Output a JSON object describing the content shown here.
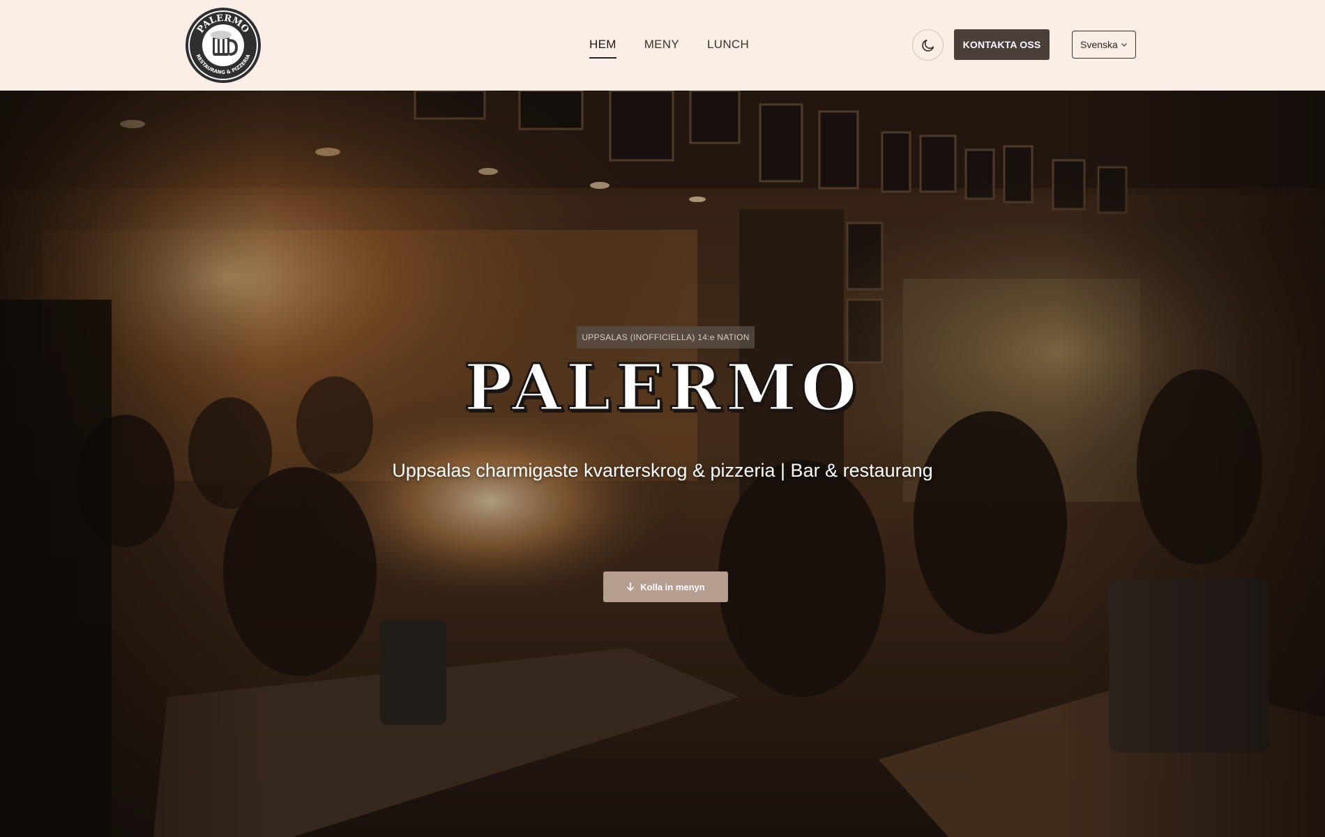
{
  "header": {
    "logo": {
      "text_top": "PALERMO",
      "text_bottom": "RESTAURANG & PIZZERIA"
    },
    "nav": [
      {
        "label": "HEM",
        "active": true
      },
      {
        "label": "MENY",
        "active": false
      },
      {
        "label": "LUNCH",
        "active": false
      }
    ],
    "theme_toggle_icon": "moon-icon",
    "contact_label": "KONTAKTA OSS",
    "language": {
      "selected": "Svenska",
      "icon": "chevron-down-icon"
    }
  },
  "hero": {
    "badge": "UPPSALAS (INOFFICIELLA) 14:e NATION",
    "title": "PALERMO",
    "subtitle": "Uppsalas charmigaste kvarterskrog & pizzeria | Bar & restaurang",
    "cta_label": "Kolla in menyn",
    "cta_icon": "arrow-down-icon"
  },
  "colors": {
    "header_bg": "#fbeee6",
    "contact_button_bg": "#4a3f39",
    "cta_button_bg": "#b59d90",
    "hero_overlay": "#1a120c"
  }
}
